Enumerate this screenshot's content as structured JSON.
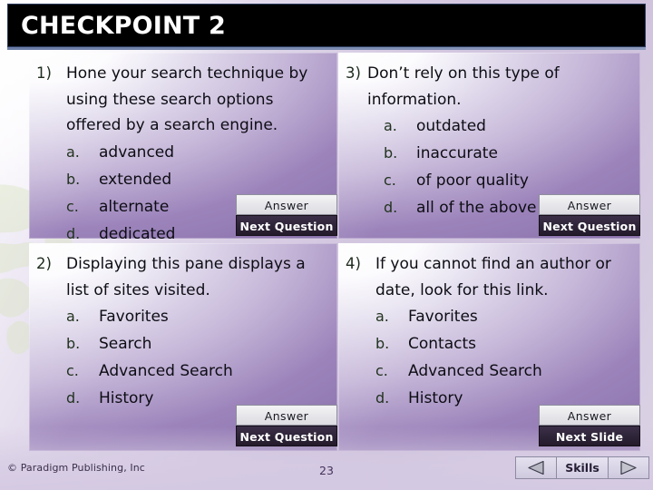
{
  "title_bar": {
    "title": "CHECKPOINT 2"
  },
  "questions": [
    {
      "number": "1)",
      "stem": "Hone your search technique by using these search options offered by a search engine.",
      "choices": [
        {
          "letter": "a.",
          "text": "advanced"
        },
        {
          "letter": "b.",
          "text": "extended"
        },
        {
          "letter": "c.",
          "text": "alternate"
        },
        {
          "letter": "d.",
          "text": "dedicated"
        }
      ],
      "answer_label": "Answer",
      "next_label": "Next Question"
    },
    {
      "number": "2)",
      "stem": "Displaying this pane displays a list of sites visited.",
      "choices": [
        {
          "letter": "a.",
          "text": "Favorites"
        },
        {
          "letter": "b.",
          "text": "Search"
        },
        {
          "letter": "c.",
          "text": "Advanced Search"
        },
        {
          "letter": "d.",
          "text": "History"
        }
      ],
      "answer_label": "Answer",
      "next_label": "Next Question"
    },
    {
      "number": "3)",
      "stem": "Don’t rely on this type of information.",
      "choices": [
        {
          "letter": "a.",
          "text": "outdated"
        },
        {
          "letter": "b.",
          "text": "inaccurate"
        },
        {
          "letter": "c.",
          "text": "of poor quality"
        },
        {
          "letter": "d.",
          "text": "all of the above"
        }
      ],
      "answer_label": "Answer",
      "next_label": "Next Question"
    },
    {
      "number": "4)",
      "stem": "If you cannot find an author or date, look for this link.",
      "choices": [
        {
          "letter": "a.",
          "text": "Favorites"
        },
        {
          "letter": "b.",
          "text": "Contacts"
        },
        {
          "letter": "c.",
          "text": "Advanced Search"
        },
        {
          "letter": "d.",
          "text": "History"
        }
      ],
      "answer_label": "Answer",
      "next_label": "Next Slide"
    }
  ],
  "footer": {
    "copyright": "© Paradigm Publishing, Inc",
    "page_number": "23",
    "nav": {
      "previous_icon": "triangle-left-icon",
      "skills_label": "Skills",
      "next_icon": "triangle-right-icon"
    }
  },
  "colors": {
    "title_bar_bg": "#000000",
    "title_bar_text": "#ffffff",
    "panel_light": "#ffffff",
    "panel_dark": "#8c73ad",
    "next_button_bg": "#2e2438",
    "answer_button_bg": "#e6e6ea",
    "slide_bg": "#d3c7e0"
  }
}
